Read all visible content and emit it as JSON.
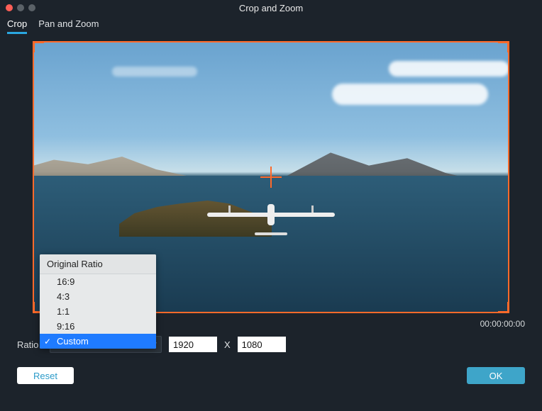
{
  "window": {
    "title": "Crop and Zoom"
  },
  "tabs": {
    "crop": "Crop",
    "panzoom": "Pan and Zoom"
  },
  "timecode": "00:00:00:00",
  "ratio": {
    "label": "Ratio",
    "selected": "Custom",
    "header": "Original Ratio",
    "options": [
      "16:9",
      "4:3",
      "1:1",
      "9:16",
      "Custom"
    ]
  },
  "dimensions": {
    "width": "1920",
    "separator": "X",
    "height": "1080"
  },
  "buttons": {
    "reset": "Reset",
    "ok": "OK"
  }
}
